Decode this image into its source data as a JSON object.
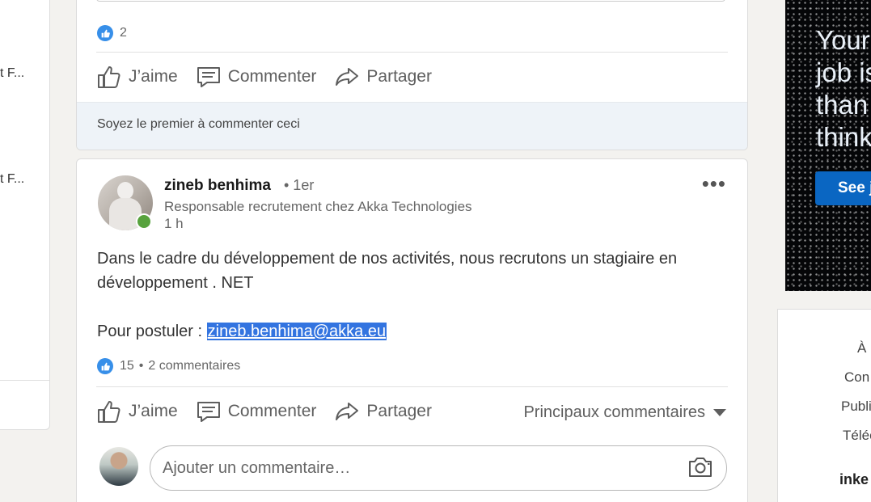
{
  "left_sidebar": {
    "snippets": [
      "t F...",
      "t F..."
    ]
  },
  "previous_post": {
    "like_count": "2",
    "actions": {
      "like": "J’aime",
      "comment": "Commenter",
      "share": "Partager"
    },
    "empty_comments": "Soyez le premier à commenter ceci"
  },
  "post": {
    "author_name": "zineb benhima",
    "degree": "• 1er",
    "headline": "Responsable recrutement chez Akka Technologies",
    "time": "1 h",
    "text_line1": "Dans le cadre du développement de nos activités, nous recrutons un stagiaire en",
    "text_line2": "développement . NET",
    "apply_label": "Pour postuler : ",
    "email": "zineb.benhima@akka.eu",
    "like_count": "15",
    "separator": "•",
    "comments_count": "2 commentaires",
    "actions": {
      "like": "J’aime",
      "comment": "Commenter",
      "share": "Partager"
    },
    "sort_label": "Principaux commentaires",
    "comment_placeholder": "Ajouter un commentaire…",
    "more_menu": "•••"
  },
  "ad": {
    "headline_lines": [
      "Your",
      "job is",
      "than",
      "think"
    ],
    "button_label": "See j"
  },
  "right_footer": {
    "links": [
      "À",
      "Con",
      "Publi",
      "Téléc"
    ],
    "logo_fragment": "inke"
  },
  "colors": {
    "brand_blue": "#0a66c2",
    "like_blue": "#378fe9",
    "presence_green": "#57a23d",
    "selection_blue": "#3374e0"
  }
}
